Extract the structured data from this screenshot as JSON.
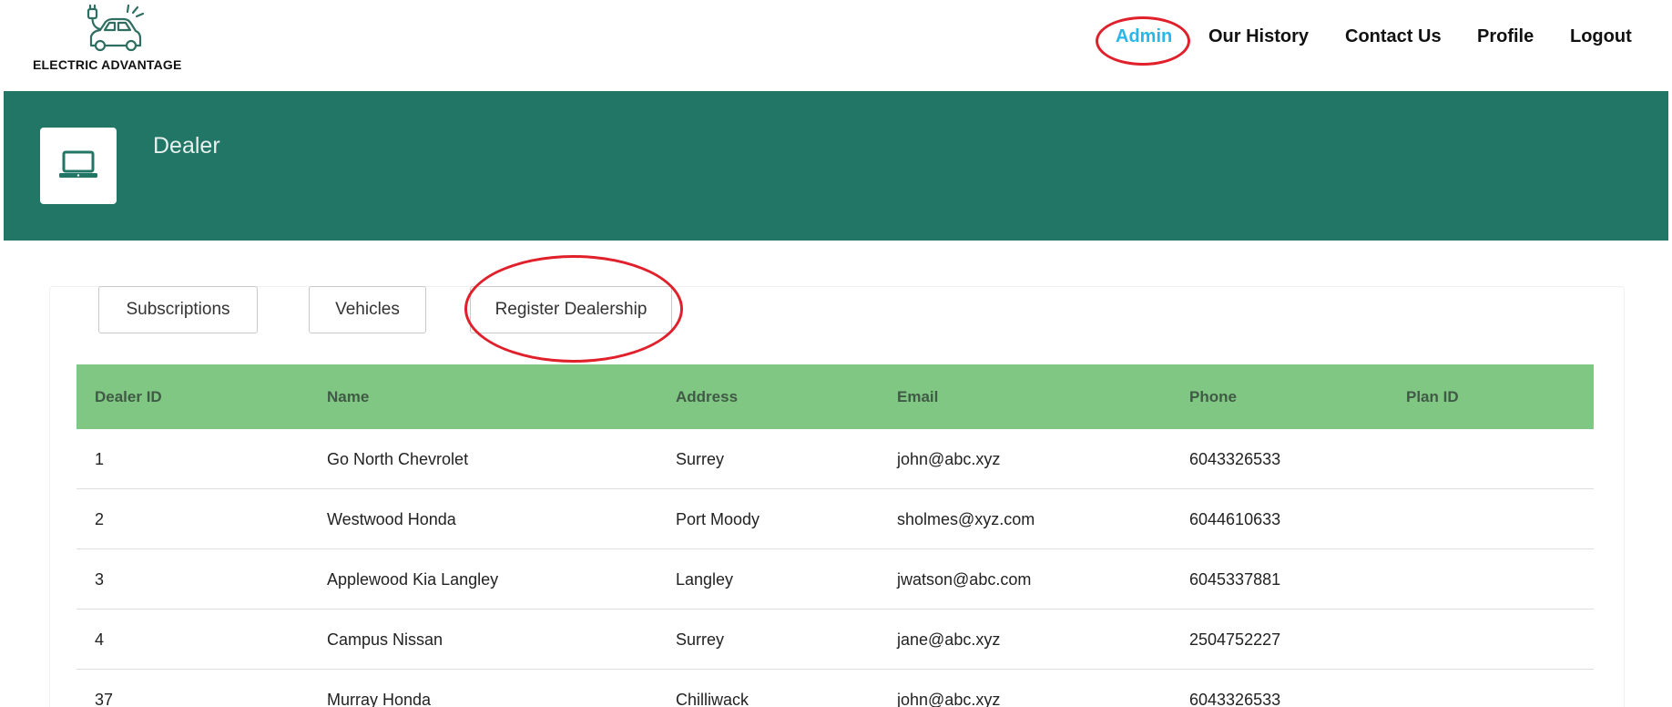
{
  "brand": {
    "name": "ELECTRIC ADVANTAGE",
    "logo_icon": "electric-car-plug-icon"
  },
  "nav": {
    "items": [
      {
        "label": "Admin",
        "active": true
      },
      {
        "label": "Our History"
      },
      {
        "label": "Contact Us"
      },
      {
        "label": "Profile"
      },
      {
        "label": "Logout"
      }
    ],
    "active_color": "#29b6e8"
  },
  "banner": {
    "title": "Dealer",
    "icon": "laptop-icon",
    "background": "#217665"
  },
  "tabs": [
    {
      "label": "Subscriptions"
    },
    {
      "label": "Vehicles"
    },
    {
      "label": "Register Dealership"
    }
  ],
  "table": {
    "header_color": "#81c784",
    "columns": [
      "Dealer ID",
      "Name",
      "Address",
      "Email",
      "Phone",
      "Plan ID"
    ],
    "rows": [
      [
        "1",
        "Go North Chevrolet",
        "Surrey",
        "john@abc.xyz",
        "6043326533",
        ""
      ],
      [
        "2",
        "Westwood Honda",
        "Port Moody",
        "sholmes@xyz.com",
        "6044610633",
        ""
      ],
      [
        "3",
        "Applewood Kia Langley",
        "Langley",
        "jwatson@abc.com",
        "6045337881",
        ""
      ],
      [
        "4",
        "Campus Nissan",
        "Surrey",
        "jane@abc.xyz",
        "2504752227",
        ""
      ],
      [
        "37",
        "Murray Honda",
        "Chilliwack",
        "john@abc.xyz",
        "6043326533",
        ""
      ]
    ]
  },
  "annotations": {
    "color": "#e0202a",
    "highlighted": [
      "Admin",
      "Register Dealership"
    ]
  }
}
